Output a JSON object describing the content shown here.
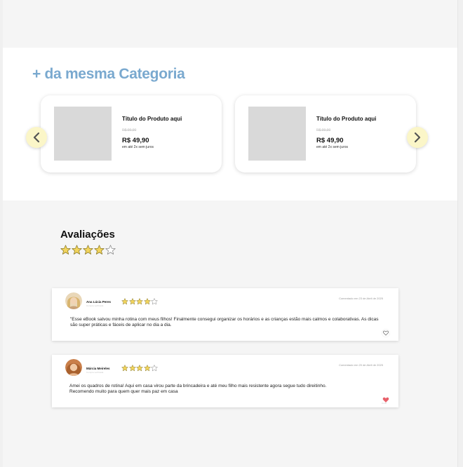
{
  "related": {
    "title": "+ da mesma Categoria",
    "products": [
      {
        "title": "Título do Produto aqui",
        "old_price": "R$ 99,90",
        "price": "R$ 49,90",
        "installments": "em até 2x sem juros"
      },
      {
        "title": "Título do Produto aqui",
        "old_price": "R$ 99,90",
        "price": "R$ 49,90",
        "installments": "em até 2x sem juros"
      }
    ],
    "prev_icon": "chevron-left-icon",
    "next_icon": "chevron-right-icon"
  },
  "reviews": {
    "title": "Avaliações",
    "overall_rating": 4,
    "max_rating": 5,
    "items": [
      {
        "name": "Ana Lúcia Peres",
        "subtitle": "Compra verificada",
        "rating": 4,
        "date": "Comentado em 23 de Abril de 2025",
        "text": "\"Esse eBook salvou minha rotina com meus filhos! Finalmente consegui organizar os horários e as crianças estão mais calmos e colaborativas. As dicas são super práticas e fáceis de aplicar no dia a dia.",
        "liked": false
      },
      {
        "name": "Márcia Meireles",
        "subtitle": "Compra verificada",
        "rating": 4,
        "date": "Comentado em 20 de Abril de 2025",
        "text": "Amei os quadros de rotina! Aqui em casa virou parte da brincadeira e até meu filho mais resistente agora segue tudo direitinho. Recomendo muito para quem quer mais paz em casa",
        "liked": true,
        "like_label": "Curtir"
      }
    ]
  },
  "colors": {
    "accent_title": "#7aa9cf",
    "arrow_bg": "#fbf6c8",
    "star": "#f2d45c",
    "heart_active": "#e8606a"
  }
}
